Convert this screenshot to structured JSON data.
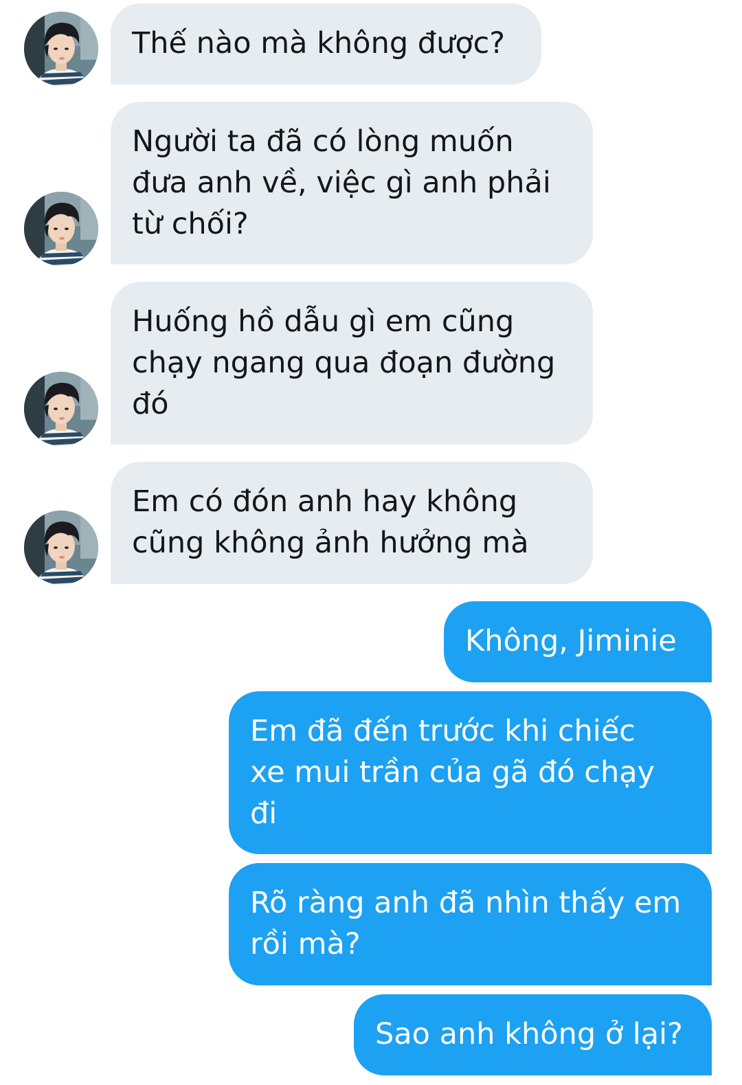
{
  "conversation": {
    "incoming": [
      {
        "text": "Thế nào mà không được?",
        "avatar_icon": "profile-photo-avatar"
      },
      {
        "text": "Người ta đã có lòng muốn\nđưa anh về, việc gì anh phải\ntừ chối?",
        "avatar_icon": "profile-photo-avatar"
      },
      {
        "text": "Huống hồ dẫu gì em cũng\nchạy ngang qua đoạn đường\nđó",
        "avatar_icon": "profile-photo-avatar"
      },
      {
        "text": "Em có đón anh hay không\ncũng không ảnh hưởng mà",
        "avatar_icon": "profile-photo-avatar"
      }
    ],
    "outgoing": [
      {
        "text": "Không, Jiminie"
      },
      {
        "text": "Em đã đến trước khi chiếc\nxe mui trần của gã đó chạy\nđi"
      },
      {
        "text": "Rõ ràng anh đã nhìn thấy em\nrồi mà?"
      },
      {
        "text": "Sao anh không ở lại?"
      }
    ]
  },
  "colors": {
    "incoming_bubble": "#e6ecf0",
    "incoming_text": "#14171a",
    "outgoing_bubble": "#1da1f2",
    "outgoing_text": "#ffffff",
    "background": "#ffffff"
  }
}
